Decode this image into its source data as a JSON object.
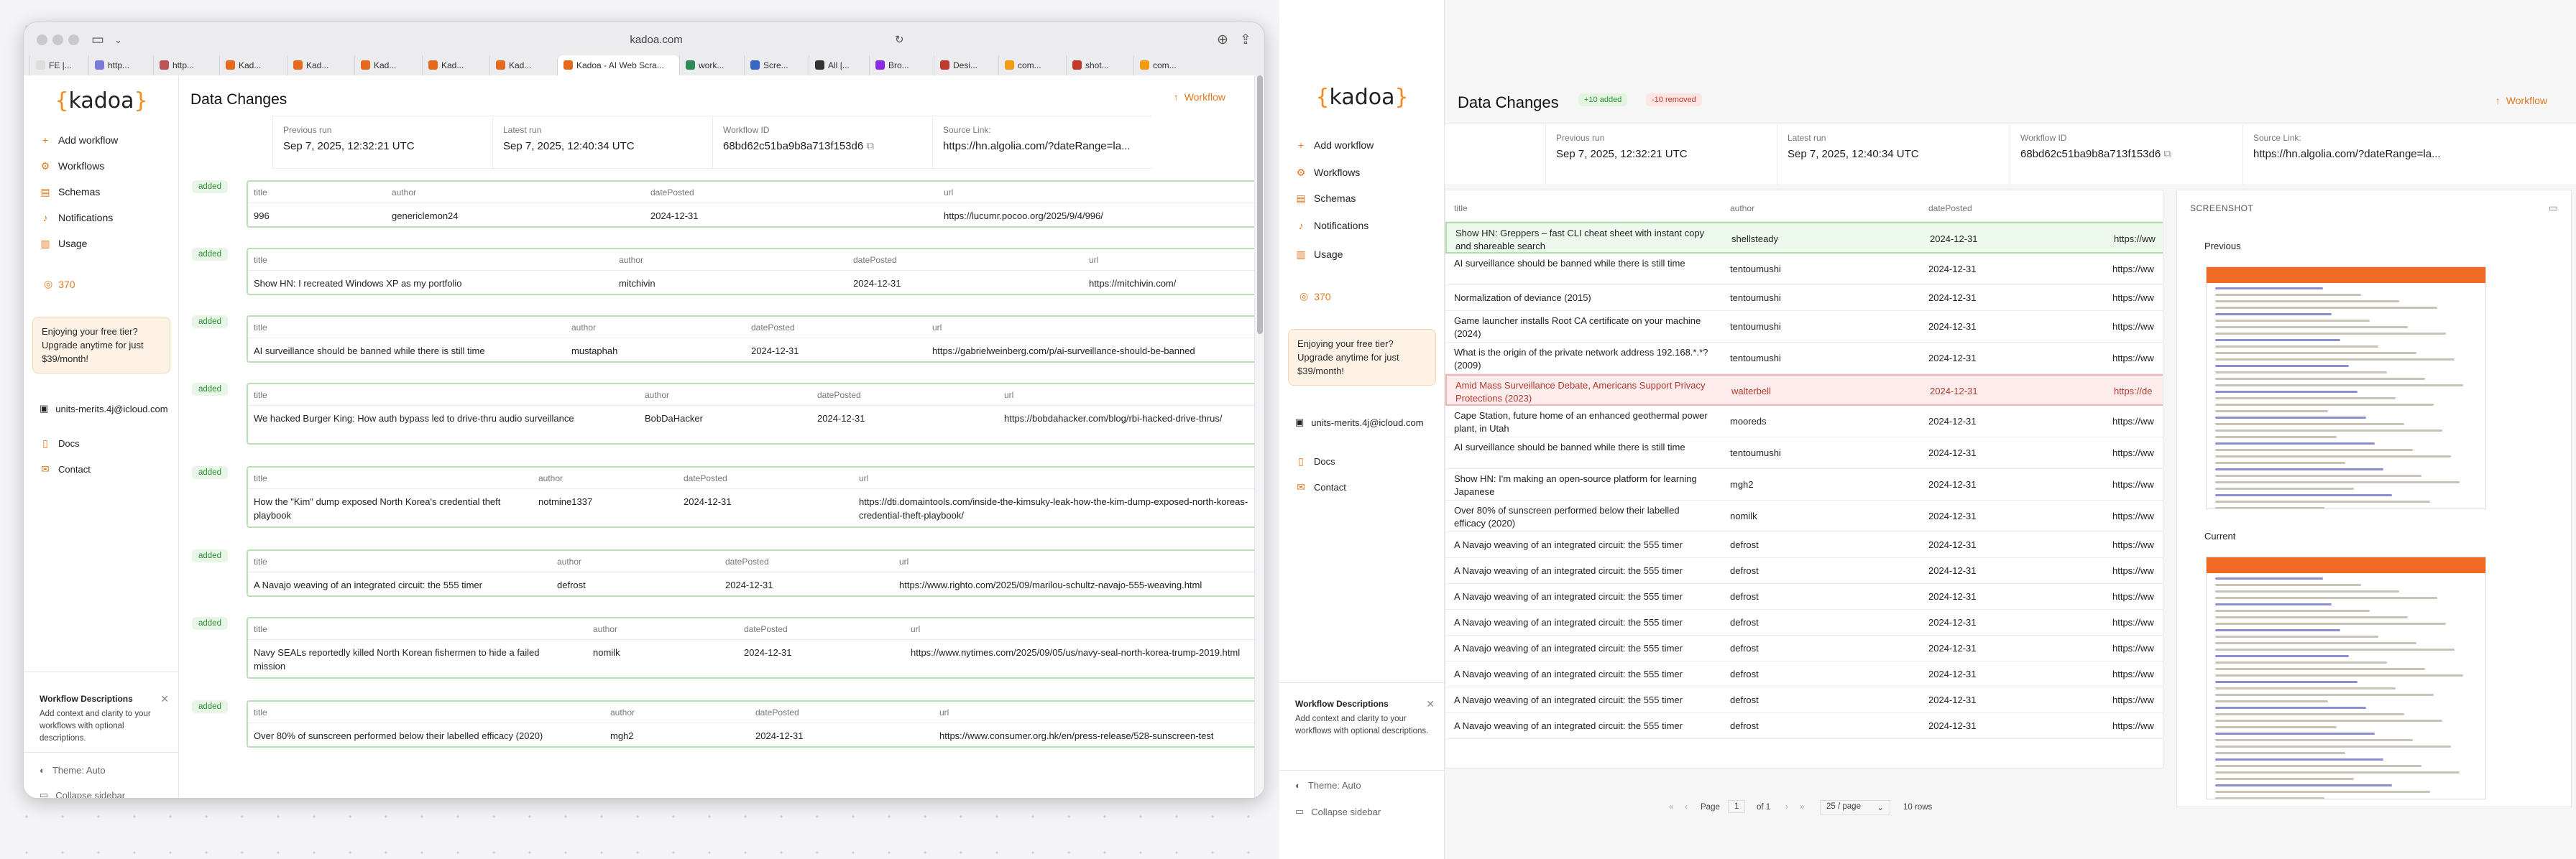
{
  "browser": {
    "url": "kadoa.com",
    "tabs": [
      "FE |...",
      "http...",
      "http...",
      "Kad...",
      "Kad...",
      "Kad...",
      "Kad...",
      "Kad...",
      "Kadoa - AI Web Scra...",
      "work...",
      "Scre...",
      "All |...",
      "Bro...",
      "Desi...",
      "com...",
      "shot...",
      "com..."
    ]
  },
  "brand": {
    "logo_open": "{",
    "logo_text": "kadoa",
    "logo_close": "}",
    "accent": "#f28a1e"
  },
  "sidebar": {
    "items": [
      {
        "label": "Add workflow",
        "icon": "plus-icon"
      },
      {
        "label": "Workflows",
        "icon": "workflow-icon"
      },
      {
        "label": "Schemas",
        "icon": "schema-icon"
      },
      {
        "label": "Notifications",
        "icon": "bell-icon"
      },
      {
        "label": "Usage",
        "icon": "chart-icon"
      }
    ],
    "credits": "370",
    "promo": "Enjoying your free tier? Upgrade anytime for just $39/month!",
    "user": "units-merits.4j@icloud.com",
    "docs": "Docs",
    "contact": "Contact",
    "desc_title": "Workflow Descriptions",
    "desc_text": "Add context and clarity to your workflows with optional descriptions.",
    "theme": "Theme: Auto",
    "collapse": "Collapse sidebar"
  },
  "page": {
    "title": "Data Changes",
    "workflow_button": "Workflow",
    "added_pill": "+10 added",
    "removed_pill": "-10 removed",
    "meta": [
      {
        "label": "Previous run",
        "value": "Sep 7, 2025, 12:32:21 UTC"
      },
      {
        "label": "Latest run",
        "value": "Sep 7, 2025, 12:40:34 UTC"
      },
      {
        "label": "Workflow ID",
        "value": "68bd62c51ba9b8a713f153d6"
      },
      {
        "label": "Source Link:",
        "value": "https://hn.algolia.com/?dateRange=la..."
      }
    ]
  },
  "columns": {
    "title": "title",
    "author": "author",
    "datePosted": "datePosted",
    "url": "url"
  },
  "added_label": "added",
  "left_records": [
    {
      "title": "996",
      "author": "genericlemon24",
      "date": "2024-12-31",
      "url": "https://lucumr.pocoo.org/2025/9/4/996/"
    },
    {
      "title": "Show HN: I recreated Windows XP as my portfolio",
      "author": "mitchivin",
      "date": "2024-12-31",
      "url": "https://mitchivin.com/"
    },
    {
      "title": "AI surveillance should be banned while there is still time",
      "author": "mustaphah",
      "date": "2024-12-31",
      "url": "https://gabrielweinberg.com/p/ai-surveillance-should-be-banned"
    },
    {
      "title": "We hacked Burger King: How auth bypass led to drive-thru audio surveillance",
      "author": "BobDaHacker",
      "date": "2024-12-31",
      "url": "https://bobdahacker.com/blog/rbi-hacked-drive-thrus/"
    },
    {
      "title": "How the \"Kim\" dump exposed North Korea's credential theft playbook",
      "author": "notmine1337",
      "date": "2024-12-31",
      "url": "https://dti.domaintools.com/inside-the-kimsuky-leak-how-the-kim-dump-exposed-north-koreas-credential-theft-playbook/"
    },
    {
      "title": "A Navajo weaving of an integrated circuit: the 555 timer",
      "author": "defrost",
      "date": "2024-12-31",
      "url": "https://www.righto.com/2025/09/marilou-schultz-navajo-555-weaving.html"
    },
    {
      "title": "Navy SEALs reportedly killed North Korean fishermen to hide a failed mission",
      "author": "nomilk",
      "date": "2024-12-31",
      "url": "https://www.nytimes.com/2025/09/05/us/navy-seal-north-korea-trump-2019.html"
    },
    {
      "title": "Over 80% of sunscreen performed below their labelled efficacy (2020)",
      "author": "mgh2",
      "date": "2024-12-31",
      "url": "https://www.consumer.org.hk/en/press-release/528-sunscreen-test"
    }
  ],
  "right_rows": [
    {
      "title": "Show HN: Greppers – fast CLI cheat sheet with instant copy and shareable search",
      "author": "shellsteady",
      "date": "2024-12-31",
      "url": "https://ww",
      "state": "add"
    },
    {
      "title": "AI surveillance should be banned while there is still time",
      "author": "tentoumushi",
      "date": "2024-12-31",
      "url": "https://ww",
      "state": ""
    },
    {
      "title": "Normalization of deviance (2015)",
      "author": "tentoumushi",
      "date": "2024-12-31",
      "url": "https://ww",
      "state": ""
    },
    {
      "title": "Game launcher installs Root CA certificate on your machine (2024)",
      "author": "tentoumushi",
      "date": "2024-12-31",
      "url": "https://ww",
      "state": ""
    },
    {
      "title": "What is the origin of the private network address 192.168.*.*? (2009)",
      "author": "tentoumushi",
      "date": "2024-12-31",
      "url": "https://ww",
      "state": ""
    },
    {
      "title": "Amid Mass Surveillance Debate, Americans Support Privacy Protections (2023)",
      "author": "walterbell",
      "date": "2024-12-31",
      "url": "https://de",
      "state": "rem"
    },
    {
      "title": "Cape Station, future home of an enhanced geothermal power plant, in Utah",
      "author": "mooreds",
      "date": "2024-12-31",
      "url": "https://ww",
      "state": ""
    },
    {
      "title": "AI surveillance should be banned while there is still time",
      "author": "tentoumushi",
      "date": "2024-12-31",
      "url": "https://ww",
      "state": ""
    },
    {
      "title": "Show HN: I'm making an open-source platform for learning Japanese",
      "author": "mgh2",
      "date": "2024-12-31",
      "url": "https://ww",
      "state": ""
    },
    {
      "title": "Over 80% of sunscreen performed below their labelled efficacy (2020)",
      "author": "nomilk",
      "date": "2024-12-31",
      "url": "https://ww",
      "state": ""
    },
    {
      "title": "A Navajo weaving of an integrated circuit: the 555 timer",
      "author": "defrost",
      "date": "2024-12-31",
      "url": "https://ww",
      "state": ""
    },
    {
      "title": "A Navajo weaving of an integrated circuit: the 555 timer",
      "author": "defrost",
      "date": "2024-12-31",
      "url": "https://ww",
      "state": ""
    },
    {
      "title": "A Navajo weaving of an integrated circuit: the 555 timer",
      "author": "defrost",
      "date": "2024-12-31",
      "url": "https://ww",
      "state": ""
    },
    {
      "title": "A Navajo weaving of an integrated circuit: the 555 timer",
      "author": "defrost",
      "date": "2024-12-31",
      "url": "https://ww",
      "state": ""
    },
    {
      "title": "A Navajo weaving of an integrated circuit: the 555 timer",
      "author": "defrost",
      "date": "2024-12-31",
      "url": "https://ww",
      "state": ""
    },
    {
      "title": "A Navajo weaving of an integrated circuit: the 555 timer",
      "author": "defrost",
      "date": "2024-12-31",
      "url": "https://ww",
      "state": ""
    },
    {
      "title": "A Navajo weaving of an integrated circuit: the 555 timer",
      "author": "defrost",
      "date": "2024-12-31",
      "url": "https://ww",
      "state": ""
    },
    {
      "title": "A Navajo weaving of an integrated circuit: the 555 timer",
      "author": "defrost",
      "date": "2024-12-31",
      "url": "https://ww",
      "state": ""
    }
  ],
  "screenshot_panel": {
    "title": "SCREENSHOT",
    "previous": "Previous",
    "current": "Current"
  },
  "pagination": {
    "page_label": "Page",
    "page": "1",
    "of": "of 1",
    "per_page": "25 / page",
    "rows": "10 rows"
  }
}
